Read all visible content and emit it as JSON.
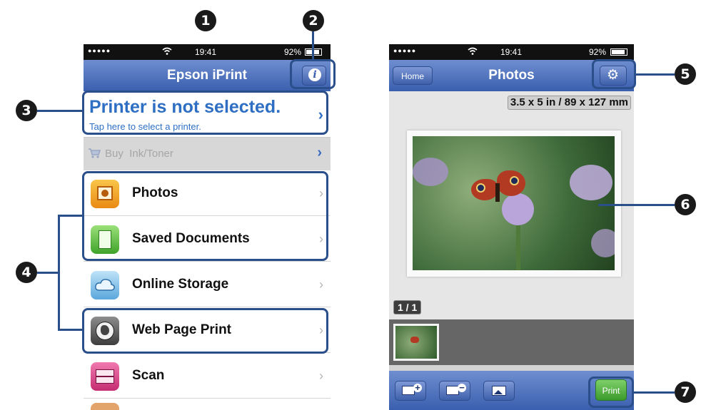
{
  "callouts": [
    "1",
    "2",
    "3",
    "4",
    "5",
    "6",
    "7"
  ],
  "left_phone": {
    "status": {
      "carrier": "●●●●●",
      "time": "19:41",
      "battery": "92%"
    },
    "nav": {
      "title": "Epson iPrint",
      "info_icon": "info-icon"
    },
    "printer_banner": {
      "title": "Printer is not selected.",
      "subtitle": "Tap here to select a printer.",
      "chevron": "›"
    },
    "buy_row": {
      "label": "Buy  Ink/Toner",
      "chevron": "›"
    },
    "menu": [
      {
        "label": "Photos",
        "icon": "photos-icon",
        "chevron": "›"
      },
      {
        "label": "Saved Documents",
        "icon": "document-icon",
        "chevron": "›"
      },
      {
        "label": "Online Storage",
        "icon": "cloud-icon",
        "chevron": "›"
      },
      {
        "label": "Web Page Print",
        "icon": "globe-icon",
        "chevron": "›"
      },
      {
        "label": "Scan",
        "icon": "scanner-icon",
        "chevron": "›"
      }
    ]
  },
  "right_phone": {
    "status": {
      "carrier": "●●●●●",
      "time": "19:41",
      "battery": "92%"
    },
    "nav": {
      "back_label": "Home",
      "title": "Photos",
      "settings_icon": "gear-icon"
    },
    "paper_size": "3.5 x 5 in / 89 x 127 mm",
    "page_counter": "1 / 1",
    "toolbar": {
      "print_label": "Print"
    }
  },
  "colors": {
    "accent": "#2b4f8a",
    "nav": "#4a6cbd",
    "print_button": "#4caf50"
  }
}
